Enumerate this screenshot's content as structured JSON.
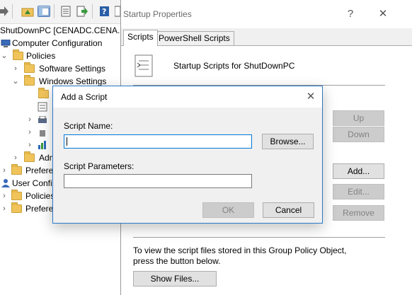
{
  "mmc": {
    "tree": [
      {
        "label": "ShutDownPC [CENADC.CENA.L"
      },
      {
        "label": "Computer Configuration"
      },
      {
        "label": "Policies"
      },
      {
        "label": "Software Settings"
      },
      {
        "label": "Windows Settings"
      },
      {
        "label": "Adm"
      },
      {
        "label": "Prefere"
      },
      {
        "label": "User Config"
      },
      {
        "label": "Policies"
      },
      {
        "label": "Prefere"
      }
    ]
  },
  "props": {
    "title": "Startup Properties",
    "help": "?",
    "close": "✕",
    "tabs": [
      {
        "label": "Scripts"
      },
      {
        "label": "PowerShell Scripts"
      }
    ],
    "header_text": "Startup Scripts for ShutDownPC",
    "buttons": {
      "up": "Up",
      "down": "Down",
      "add": "Add...",
      "edit": "Edit...",
      "remove": "Remove",
      "show_files": "Show Files..."
    },
    "footer_text": "To view the script files stored in this Group Policy Object, press the button below."
  },
  "dialog": {
    "title": "Add a Script",
    "close": "✕",
    "script_name_label": "Script Name:",
    "script_name_value": "",
    "script_params_label": "Script Parameters:",
    "script_params_value": "",
    "browse": "Browse...",
    "ok": "OK",
    "cancel": "Cancel"
  }
}
